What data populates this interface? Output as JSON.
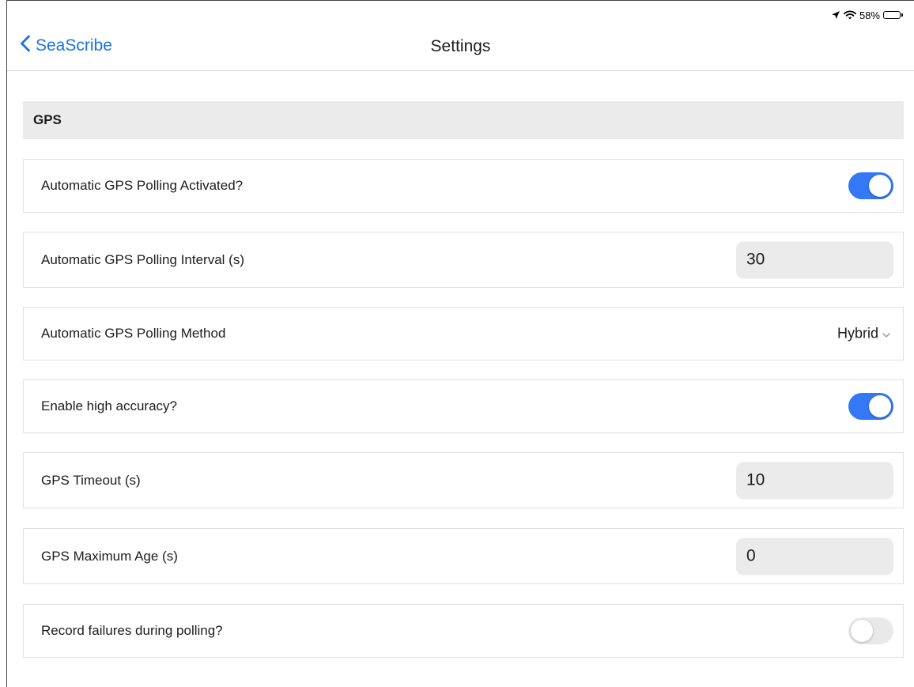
{
  "status_bar": {
    "battery_text": "58%",
    "battery_level": 0.58
  },
  "nav": {
    "back_label": "SeaScribe",
    "title": "Settings"
  },
  "section": {
    "title": "GPS"
  },
  "settings": {
    "auto_polling_activated": {
      "label": "Automatic GPS Polling Activated?",
      "value": true
    },
    "polling_interval": {
      "label": "Automatic GPS Polling Interval (s)",
      "value": "30"
    },
    "polling_method": {
      "label": "Automatic GPS Polling Method",
      "value": "Hybrid"
    },
    "high_accuracy": {
      "label": "Enable high accuracy?",
      "value": true
    },
    "gps_timeout": {
      "label": "GPS Timeout (s)",
      "value": "10"
    },
    "gps_max_age": {
      "label": "GPS Maximum Age (s)",
      "value": "0"
    },
    "record_failures": {
      "label": "Record failures during polling?",
      "value": false
    }
  },
  "colors": {
    "accent": "#3478f6",
    "link": "#1a73e8",
    "toggle_off": "#e9e9ea",
    "section_bg": "#ebebeb"
  },
  "icons": {
    "back": "chevron-left-icon",
    "location": "location-arrow-icon",
    "wifi": "wifi-icon",
    "battery": "battery-icon",
    "dropdown": "chevron-down-icon"
  }
}
